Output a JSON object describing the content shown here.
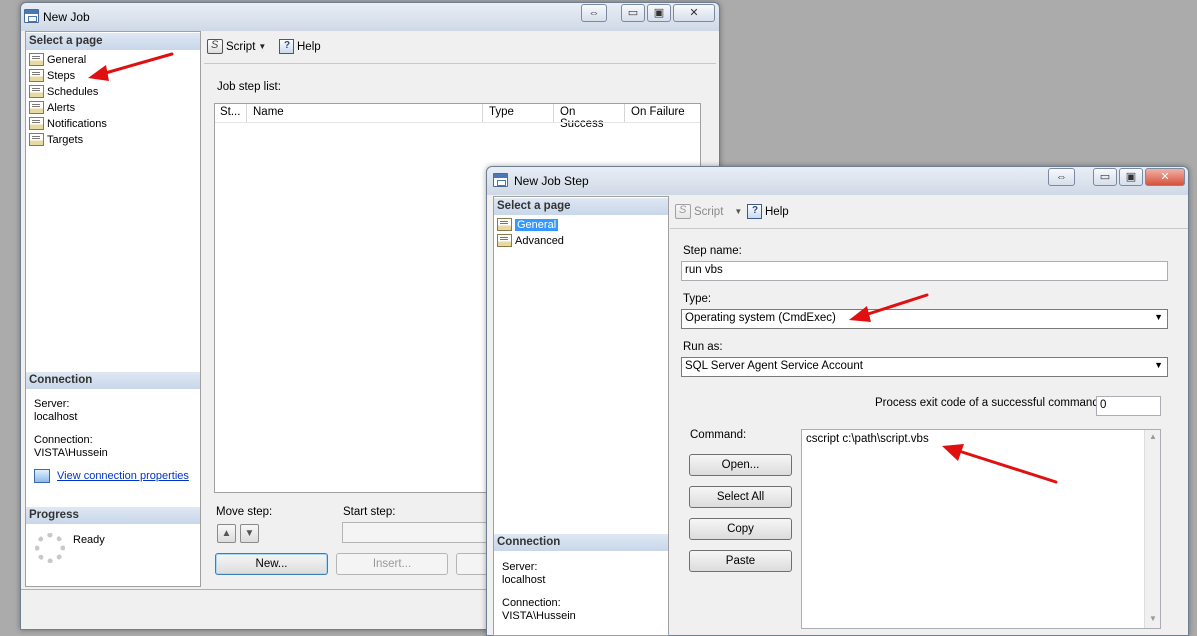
{
  "job_window": {
    "title": "New Job",
    "select_page_header": "Select a page",
    "pages": [
      "General",
      "Steps",
      "Schedules",
      "Alerts",
      "Notifications",
      "Targets"
    ],
    "selected_page": "Steps",
    "toolbar": {
      "script_label": "Script",
      "help_label": "Help"
    },
    "job_step_list_label": "Job step list:",
    "columns": [
      "St...",
      "Name",
      "Type",
      "On Success",
      "On Failure"
    ],
    "connection": {
      "header": "Connection",
      "server_label": "Server:",
      "server_value": "localhost",
      "connection_label": "Connection:",
      "connection_value": "VISTA\\Hussein",
      "view_properties_link": "View connection properties"
    },
    "progress": {
      "header": "Progress",
      "status": "Ready"
    },
    "move_step_label": "Move step:",
    "start_step_label": "Start step:",
    "buttons": {
      "new": "New...",
      "insert": "Insert..."
    }
  },
  "step_window": {
    "title": "New Job Step",
    "select_page_header": "Select a page",
    "pages": [
      "General",
      "Advanced"
    ],
    "selected_page": "General",
    "toolbar": {
      "script_label": "Script",
      "help_label": "Help"
    },
    "step_name_label": "Step name:",
    "step_name_value": "run vbs",
    "type_label": "Type:",
    "type_value": "Operating system (CmdExec)",
    "run_as_label": "Run as:",
    "run_as_value": "SQL Server Agent Service Account",
    "exit_code_label": "Process exit code of a successful command:",
    "exit_code_value": "0",
    "command_label": "Command:",
    "command_value": "cscript c:\\path\\script.vbs",
    "buttons": {
      "open": "Open...",
      "select_all": "Select All",
      "copy": "Copy",
      "paste": "Paste"
    },
    "connection": {
      "header": "Connection",
      "server_label": "Server:",
      "server_value": "localhost",
      "connection_label": "Connection:",
      "connection_value": "VISTA\\Hussein"
    }
  },
  "colors": {
    "annotation_arrow": "#e01010",
    "selection": "#3399ff",
    "section_header": "#c8d7ea"
  }
}
